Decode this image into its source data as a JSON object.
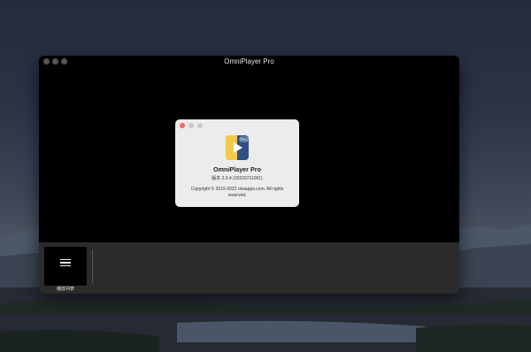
{
  "window": {
    "title": "OmniPlayer Pro"
  },
  "about": {
    "app_name": "OmniPlayer Pro",
    "version": "版本 2.0.4 (20220711001)",
    "copyright": "Copyright © 2019-2022 okaapps.com. All rights reserved.",
    "icon_badge": "PRO"
  },
  "playlist": {
    "label": "播放列表",
    "icon": "list-icon"
  },
  "colors": {
    "dialog_close": "#ed6a5e",
    "dialog_inactive": "#c9c9c9",
    "icon_yellow": "#f2c94c",
    "icon_blue": "#2f4e86"
  }
}
